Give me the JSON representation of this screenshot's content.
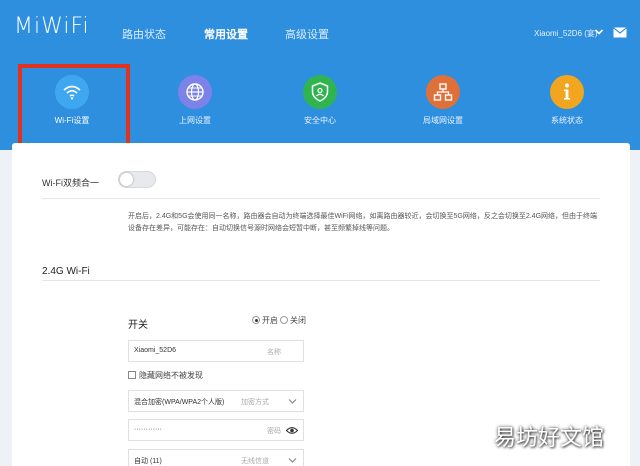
{
  "brand": {
    "logo": "MiWiFi"
  },
  "nav": {
    "status": "路由状态",
    "common": "常用设置",
    "advanced": "高级设置"
  },
  "account": {
    "label": "Xiaomi_52D6 (宴)"
  },
  "colors": {
    "header": "#2f8fdf",
    "highlight": "#e1321f",
    "wifi": "#3fa7f0",
    "internet": "#7d82e8",
    "security": "#2fb450",
    "lan": "#e0703a",
    "system": "#f2a51e"
  },
  "tiles": [
    {
      "label": "Wi-Fi设置",
      "icon": "wifi-icon",
      "active": true
    },
    {
      "label": "上网设置",
      "icon": "globe-icon",
      "active": false
    },
    {
      "label": "安全中心",
      "icon": "shield-icon",
      "active": false
    },
    {
      "label": "局域网设置",
      "icon": "network-icon",
      "active": false
    },
    {
      "label": "系统状态",
      "icon": "info-icon",
      "active": false
    }
  ],
  "dualband": {
    "label": "Wi-Fi双频合一",
    "enabled": false,
    "description": "开启后，2.4G和5G会使用同一名称，路由器会自动为终端选择最佳WiFi网络，如离路由器较近，会切换至5G网络，反之会切换至2.4G网络，但由于终端设备存在差异，可能存在：自动切换信号源时网络会短暂中断，甚至频繁掉线等问题。"
  },
  "wifi24": {
    "section_title": "2.4G Wi-Fi",
    "switch_label": "开关",
    "on_label": "开启",
    "off_label": "关闭",
    "selected": "on",
    "ssid": {
      "value": "Xiaomi_52D6",
      "hint": "名称"
    },
    "hide_label": "隐藏网络不被发现",
    "encryption": {
      "value": "混合加密(WPA/WPA2个人版)",
      "hint": "加密方式"
    },
    "password": {
      "value": "············",
      "hint": "密码"
    },
    "channel": {
      "value": "自动 (11)",
      "hint": "无线信道"
    }
  },
  "watermark": "易坊好文馆"
}
